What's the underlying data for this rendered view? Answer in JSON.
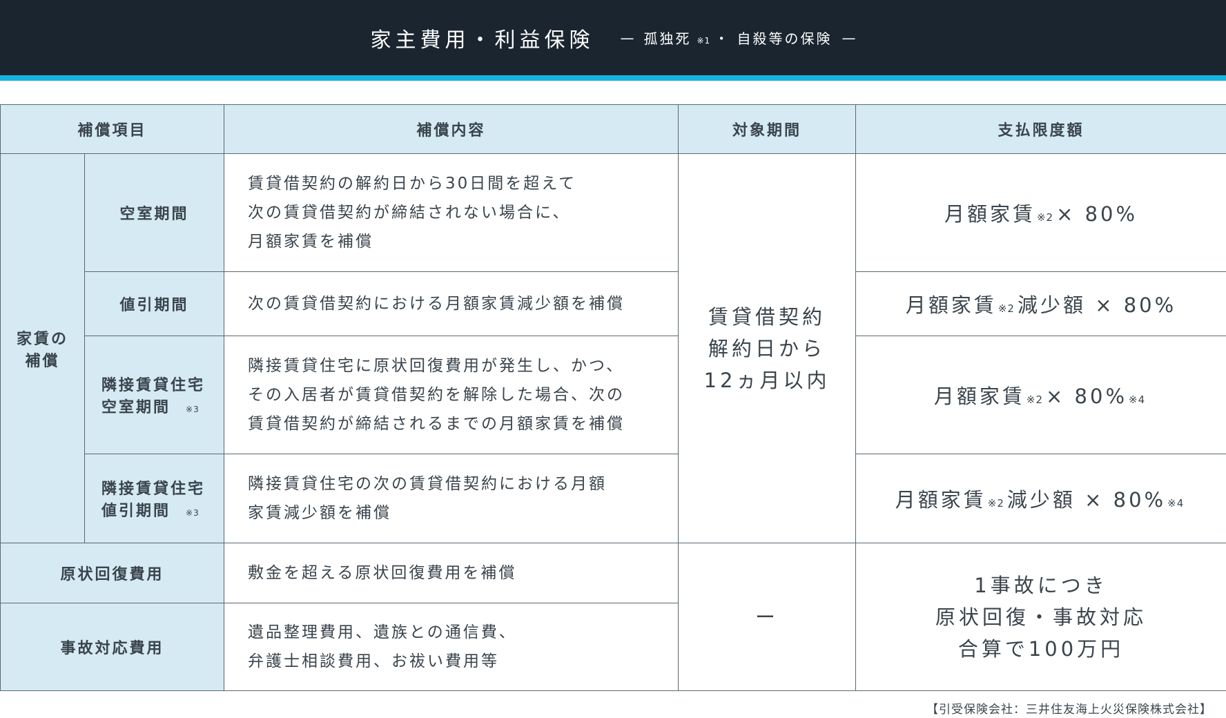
{
  "header": {
    "title": "家主費用・利益保険",
    "sub_dash_left": "—",
    "sub_text_a": "孤独死",
    "sub_note": "※1",
    "sub_text_b": "・ 自殺等の保険",
    "sub_dash_right": "—"
  },
  "colors": {
    "header_bg": "#1a2530",
    "accent_line": "#17b4e2",
    "label_bg": "#d6eaf4",
    "border": "#5a6770"
  },
  "table": {
    "headers": [
      "補償項目",
      "補償内容",
      "対象期間",
      "支払限度額"
    ],
    "group_label_1": "家賃の",
    "group_label_2": "補償",
    "rows": [
      {
        "label_1": "空室期間",
        "label_2": "",
        "label_note": "",
        "content": [
          "賃貸借契約の解約日から30日間を超えて",
          "次の賃貸借契約が締結されない場合に、",
          "月額家賃を補償"
        ],
        "limit_a": "月額家賃",
        "limit_note_a": "※2",
        "limit_b": "× 80%",
        "limit_note_b": ""
      },
      {
        "label_1": "値引期間",
        "label_2": "",
        "label_note": "",
        "content": [
          "次の賃貸借契約における月額家賃減少額を補償"
        ],
        "limit_a": "月額家賃",
        "limit_note_a": "※2",
        "limit_b": "減少額 × 80%",
        "limit_note_b": ""
      },
      {
        "label_1": "隣接賃貸住宅",
        "label_2": "空室期間",
        "label_note": "※3",
        "content": [
          "隣接賃貸住宅に原状回復費用が発生し、かつ、",
          "その入居者が賃貸借契約を解除した場合、次の",
          "賃貸借契約が締結されるまでの月額家賃を補償"
        ],
        "limit_a": "月額家賃",
        "limit_note_a": "※2",
        "limit_b": "× 80%",
        "limit_note_b": "※4"
      },
      {
        "label_1": "隣接賃貸住宅",
        "label_2": "値引期間",
        "label_note": "※3",
        "content": [
          "隣接賃貸住宅の次の賃貸借契約における月額",
          "家賃減少額を補償"
        ],
        "limit_a": "月額家賃",
        "limit_note_a": "※2",
        "limit_b": "減少額 × 80%",
        "limit_note_b": "※4"
      }
    ],
    "period_rent": [
      "賃貸借契約",
      "解約日から",
      "12ヵ月以内"
    ],
    "restore": {
      "label": "原状回復費用",
      "content": [
        "敷金を超える原状回復費用を補償"
      ]
    },
    "accident": {
      "label": "事故対応費用",
      "content": [
        "遺品整理費用、遺族との通信費、",
        "弁護士相談費用、お祓い費用等"
      ]
    },
    "period_other": "ー",
    "limit_other": [
      "1事故につき",
      "原状回復・事故対応",
      "合算で100万円"
    ]
  },
  "footer": "【引受保険会社：三井住友海上火災保険株式会社】"
}
